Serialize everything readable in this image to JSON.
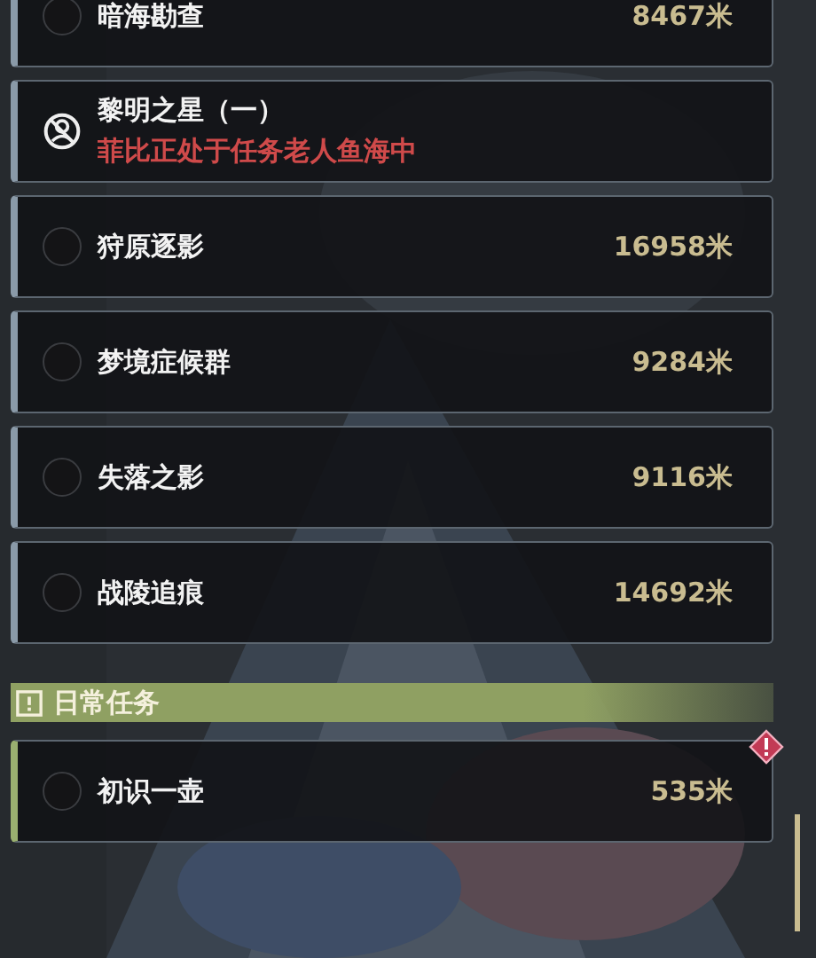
{
  "main_quests": [
    {
      "kind": "normal",
      "name": "暗海勘查",
      "distance": "8467米"
    },
    {
      "kind": "blocked",
      "name": "黎明之星（一）",
      "status": "菲比正处于任务老人鱼海中"
    },
    {
      "kind": "normal",
      "name": "狩原逐影",
      "distance": "16958米"
    },
    {
      "kind": "normal",
      "name": "梦境症候群",
      "distance": "9284米"
    },
    {
      "kind": "normal",
      "name": "失落之影",
      "distance": "9116米"
    },
    {
      "kind": "normal",
      "name": "战陵追痕",
      "distance": "14692米"
    }
  ],
  "daily_section": {
    "title": "日常任务",
    "quests": [
      {
        "kind": "normal",
        "name": "初识一壶",
        "distance": "535米",
        "alert": true
      }
    ]
  }
}
